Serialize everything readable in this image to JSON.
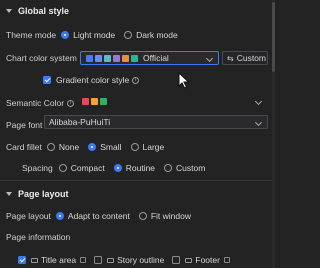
{
  "global_style": {
    "title": "Global style",
    "theme_mode": {
      "label": "Theme mode",
      "options": [
        "Light mode",
        "Dark mode"
      ],
      "selected": "Light mode"
    },
    "chart_color_system": {
      "label": "Chart color system",
      "value": "Official",
      "swatches": [
        "#4b7bf2",
        "#6b8ee8",
        "#5dbac9",
        "#9a78d8",
        "#e8913a",
        "#2bb39a"
      ],
      "custom_label": "Custom"
    },
    "gradient_color_style": {
      "label": "Gradient color style",
      "checked": true
    },
    "semantic_color": {
      "label": "Semantic Color",
      "swatches": [
        "#e24b5a",
        "#f5a623",
        "#2fb35d"
      ]
    },
    "page_font": {
      "label": "Page font",
      "value": "Alibaba-PuHuiTi"
    },
    "card_fillet": {
      "label": "Card fillet",
      "options": [
        "None",
        "Small",
        "Large"
      ],
      "selected": "Small"
    },
    "spacing": {
      "label": "Spacing",
      "options": [
        "Compact",
        "Routine",
        "Custom"
      ],
      "selected": "Routine"
    }
  },
  "page_layout": {
    "title": "Page layout",
    "layout": {
      "label": "Page layout",
      "options": [
        "Adapt to content",
        "Fit window"
      ],
      "selected": "Adapt to content"
    },
    "page_information": {
      "label": "Page information",
      "items": [
        {
          "label": "Title area",
          "checked": true
        },
        {
          "label": "Story outline",
          "checked": false
        },
        {
          "label": "Footer",
          "checked": false
        }
      ]
    }
  },
  "colors": {
    "background": "#232324",
    "accent": "#3a7bf5"
  }
}
